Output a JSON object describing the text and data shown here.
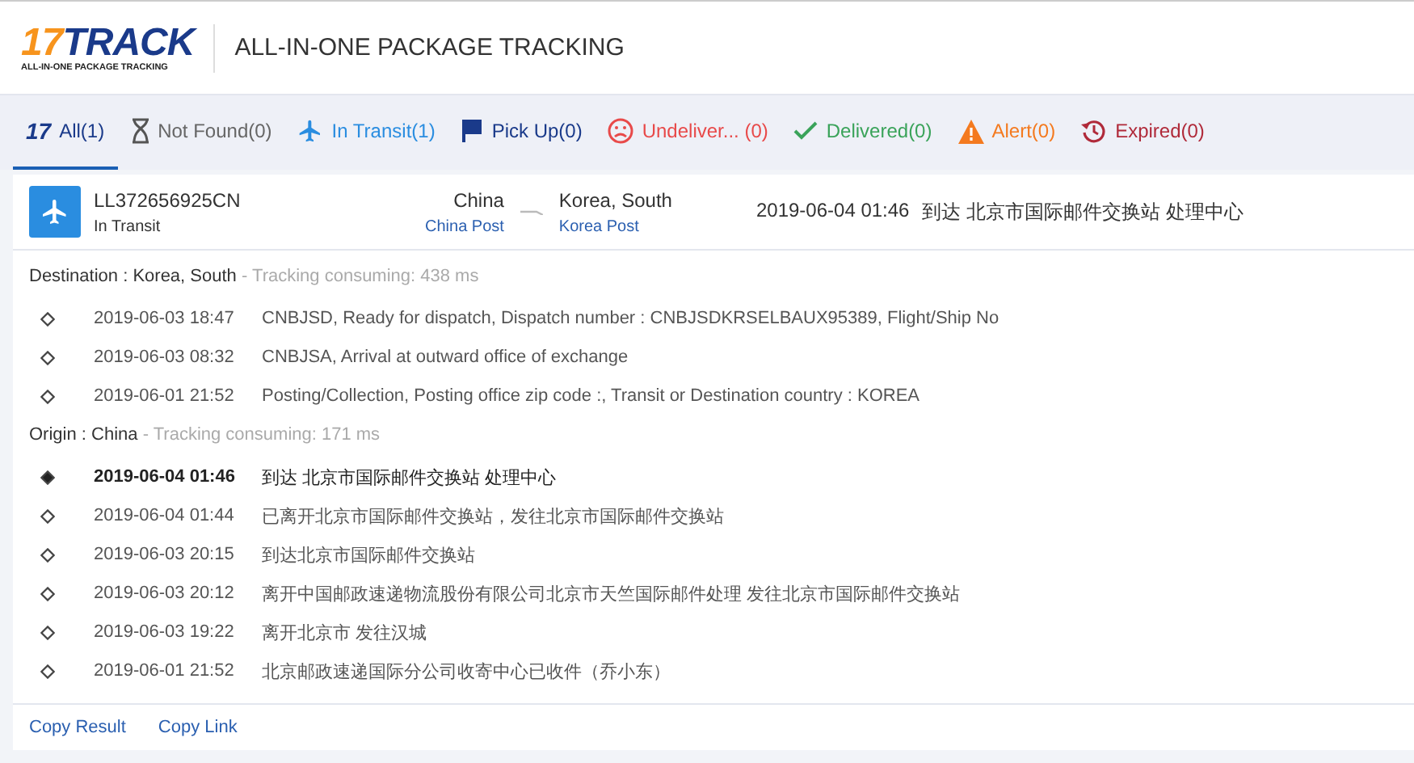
{
  "header": {
    "logo": {
      "number": "17",
      "word": "TRACK",
      "tagline": "ALL-IN-ONE PACKAGE TRACKING"
    },
    "title": "ALL-IN-ONE PACKAGE TRACKING"
  },
  "tabs": [
    {
      "kind": "all",
      "icon_text": "17",
      "label": "All(1)",
      "selected": true,
      "color": "#1a3a8a"
    },
    {
      "kind": "not_found",
      "label": "Not Found(0)",
      "selected": false,
      "color": "#666666"
    },
    {
      "kind": "in_transit",
      "label": "In Transit(1)",
      "selected": false,
      "color": "#2a8de0"
    },
    {
      "kind": "pick_up",
      "label": "Pick Up(0)",
      "selected": false,
      "color": "#1a3a8a"
    },
    {
      "kind": "undelivered",
      "label": "Undeliver... (0)",
      "selected": false,
      "color": "#e84a4a"
    },
    {
      "kind": "delivered",
      "label": "Delivered(0)",
      "selected": false,
      "color": "#3aa35a"
    },
    {
      "kind": "alert",
      "label": "Alert(0)",
      "selected": false,
      "color": "#f47a1f"
    },
    {
      "kind": "expired",
      "label": "Expired(0)",
      "selected": false,
      "color": "#b02a3a"
    }
  ],
  "package": {
    "number": "LL372656925CN",
    "status": "In Transit",
    "origin": {
      "country": "China",
      "carrier": "China Post"
    },
    "destination": {
      "country": "Korea, South",
      "carrier": "Korea Post"
    },
    "latest_time": "2019-06-04 01:46",
    "latest_event": "到达 北京市国际邮件交换站 处理中心"
  },
  "sections": [
    {
      "label": "Destination : Korea, South",
      "consuming": "- Tracking consuming: 438 ms",
      "events": [
        {
          "time": "2019-06-03 18:47",
          "text": "CNBJSD, Ready for dispatch, Dispatch number : CNBJSDKRSELBAUX95389, Flight/Ship No",
          "latest": false
        },
        {
          "time": "2019-06-03 08:32",
          "text": "CNBJSA, Arrival at outward office of exchange",
          "latest": false
        },
        {
          "time": "2019-06-01 21:52",
          "text": "Posting/Collection, Posting office zip code :, Transit or Destination country : KOREA",
          "latest": false
        }
      ]
    },
    {
      "label": "Origin : China",
      "consuming": "- Tracking consuming: 171 ms",
      "events": [
        {
          "time": "2019-06-04 01:46",
          "text": "到达 北京市国际邮件交换站 处理中心",
          "latest": true
        },
        {
          "time": "2019-06-04 01:44",
          "text": "已离开北京市国际邮件交换站，发往北京市国际邮件交换站",
          "latest": false
        },
        {
          "time": "2019-06-03 20:15",
          "text": "到达北京市国际邮件交换站",
          "latest": false
        },
        {
          "time": "2019-06-03 20:12",
          "text": "离开中国邮政速递物流股份有限公司北京市天竺国际邮件处理 发往北京市国际邮件交换站",
          "latest": false
        },
        {
          "time": "2019-06-03 19:22",
          "text": "离开北京市 发往汉城",
          "latest": false
        },
        {
          "time": "2019-06-01 21:52",
          "text": "北京邮政速递国际分公司收寄中心已收件（乔小东）",
          "latest": false
        }
      ]
    }
  ],
  "footer_links": [
    "Copy Result",
    "Copy Link"
  ]
}
